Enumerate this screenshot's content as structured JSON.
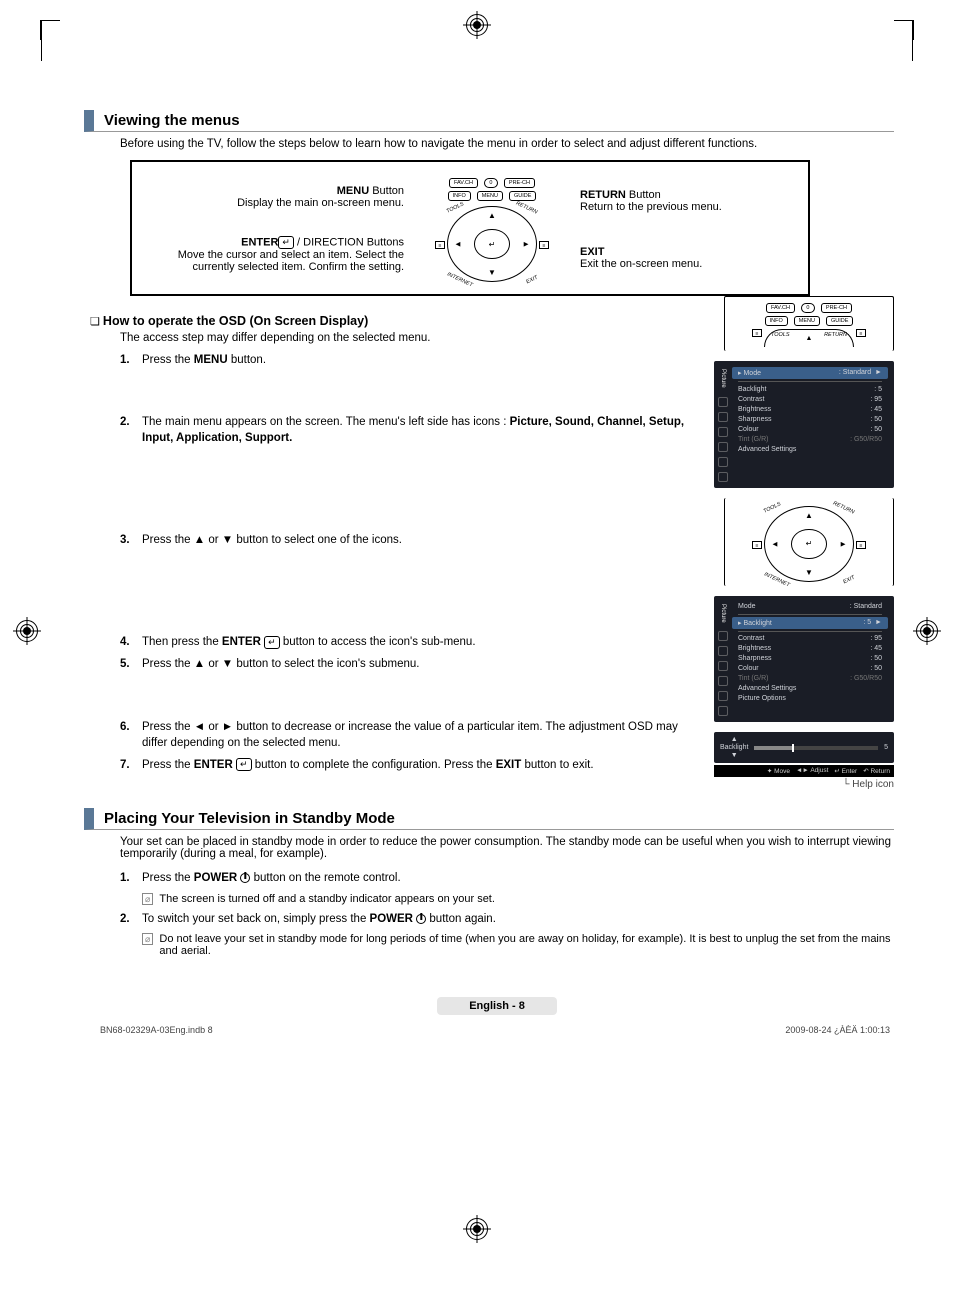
{
  "section1": {
    "title": "Viewing the menus",
    "intro": "Before using the TV, follow the steps below to learn how to navigate the menu in order to select and adjust different functions.",
    "remote": {
      "menu": {
        "title": "MENU",
        "suffix": " Button",
        "desc": "Display the main on-screen menu."
      },
      "enter": {
        "title": "ENTER",
        "suffix": " / DIRECTION Buttons",
        "desc": "Move the cursor and select an item. Select the currently selected item. Confirm the setting."
      },
      "return": {
        "title": "RETURN",
        "suffix": " Button",
        "desc": "Return to the previous menu."
      },
      "exit": {
        "title": "EXIT",
        "desc": "Exit the on-screen menu."
      },
      "buttons": {
        "favch": "FAV.CH",
        "zero": "0",
        "prech": "PRE-CH",
        "info": "INFO",
        "menu": "MENU",
        "guide": "GUIDE",
        "tools": "TOOLS",
        "return": "RETURN",
        "internet": "INTERNET",
        "exit": "EXIT"
      }
    },
    "howto": {
      "heading": "How to operate the OSD (On Screen Display)",
      "sub": "The access step may differ depending on the selected menu.",
      "steps": {
        "1": {
          "a": "Press the ",
          "b": "MENU",
          "c": " button."
        },
        "2": {
          "a": "The main menu appears on the screen. The menu's left side has icons : ",
          "b": "Picture, Sound, Channel, Setup, Input, Application, Support."
        },
        "3": "Press the ▲ or ▼ button to select one of the icons.",
        "4": {
          "a": "Then press the ",
          "b": "ENTER",
          "c": " button to access the icon's sub-menu."
        },
        "5": "Press the ▲ or ▼ button to select the icon's submenu.",
        "6": "Press the ◄ or ► button to decrease or increase the value of a particular item. The adjustment OSD may differ depending on the selected menu.",
        "7": {
          "a": "Press the ",
          "b": "ENTER",
          "c": " button to complete the configuration. Press the ",
          "d": "EXIT",
          "e": " button to exit."
        }
      }
    },
    "osd": {
      "sidebar_label": "Picture",
      "rows": {
        "mode": {
          "label": "Mode",
          "value": "Standard"
        },
        "backlight": {
          "label": "Backlight",
          "value": "5"
        },
        "contrast": {
          "label": "Contrast",
          "value": "95"
        },
        "brightness": {
          "label": "Brightness",
          "value": "45"
        },
        "sharpness": {
          "label": "Sharpness",
          "value": "50"
        },
        "colour": {
          "label": "Colour",
          "value": "50"
        },
        "tint": {
          "label": "Tint (G/R)",
          "value": "G50/R50"
        },
        "adv": {
          "label": "Advanced Settings"
        },
        "popt": {
          "label": "Picture Options"
        }
      },
      "slider_label": "Backlight",
      "slider_value": "5",
      "helpbar": {
        "move": "Move",
        "adjust": "Adjust",
        "enter": "Enter",
        "return": "Return"
      },
      "help_icon": "Help icon"
    }
  },
  "section2": {
    "title": "Placing Your Television in Standby Mode",
    "intro": "Your set can be placed in standby mode in order to reduce the power consumption. The standby mode can be useful when you wish to interrupt viewing temporarily (during a meal, for example).",
    "steps": {
      "1": {
        "a": "Press the ",
        "b": "POWER",
        "c": " button on the remote control."
      },
      "1note": "The screen is turned off and a standby indicator appears on your set.",
      "2": {
        "a": "To switch your set back on, simply press the ",
        "b": "POWER",
        "c": " button again."
      },
      "2note": "Do not leave your set in standby mode for long periods of time (when you are away on holiday, for example). It is best to unplug the set from the mains and aerial."
    }
  },
  "footer": {
    "lang_page": "English - 8",
    "doc": "BN68-02329A-03Eng.indb   8",
    "stamp": "2009-08-24   ¿ÀÈÄ 1:00:13"
  }
}
